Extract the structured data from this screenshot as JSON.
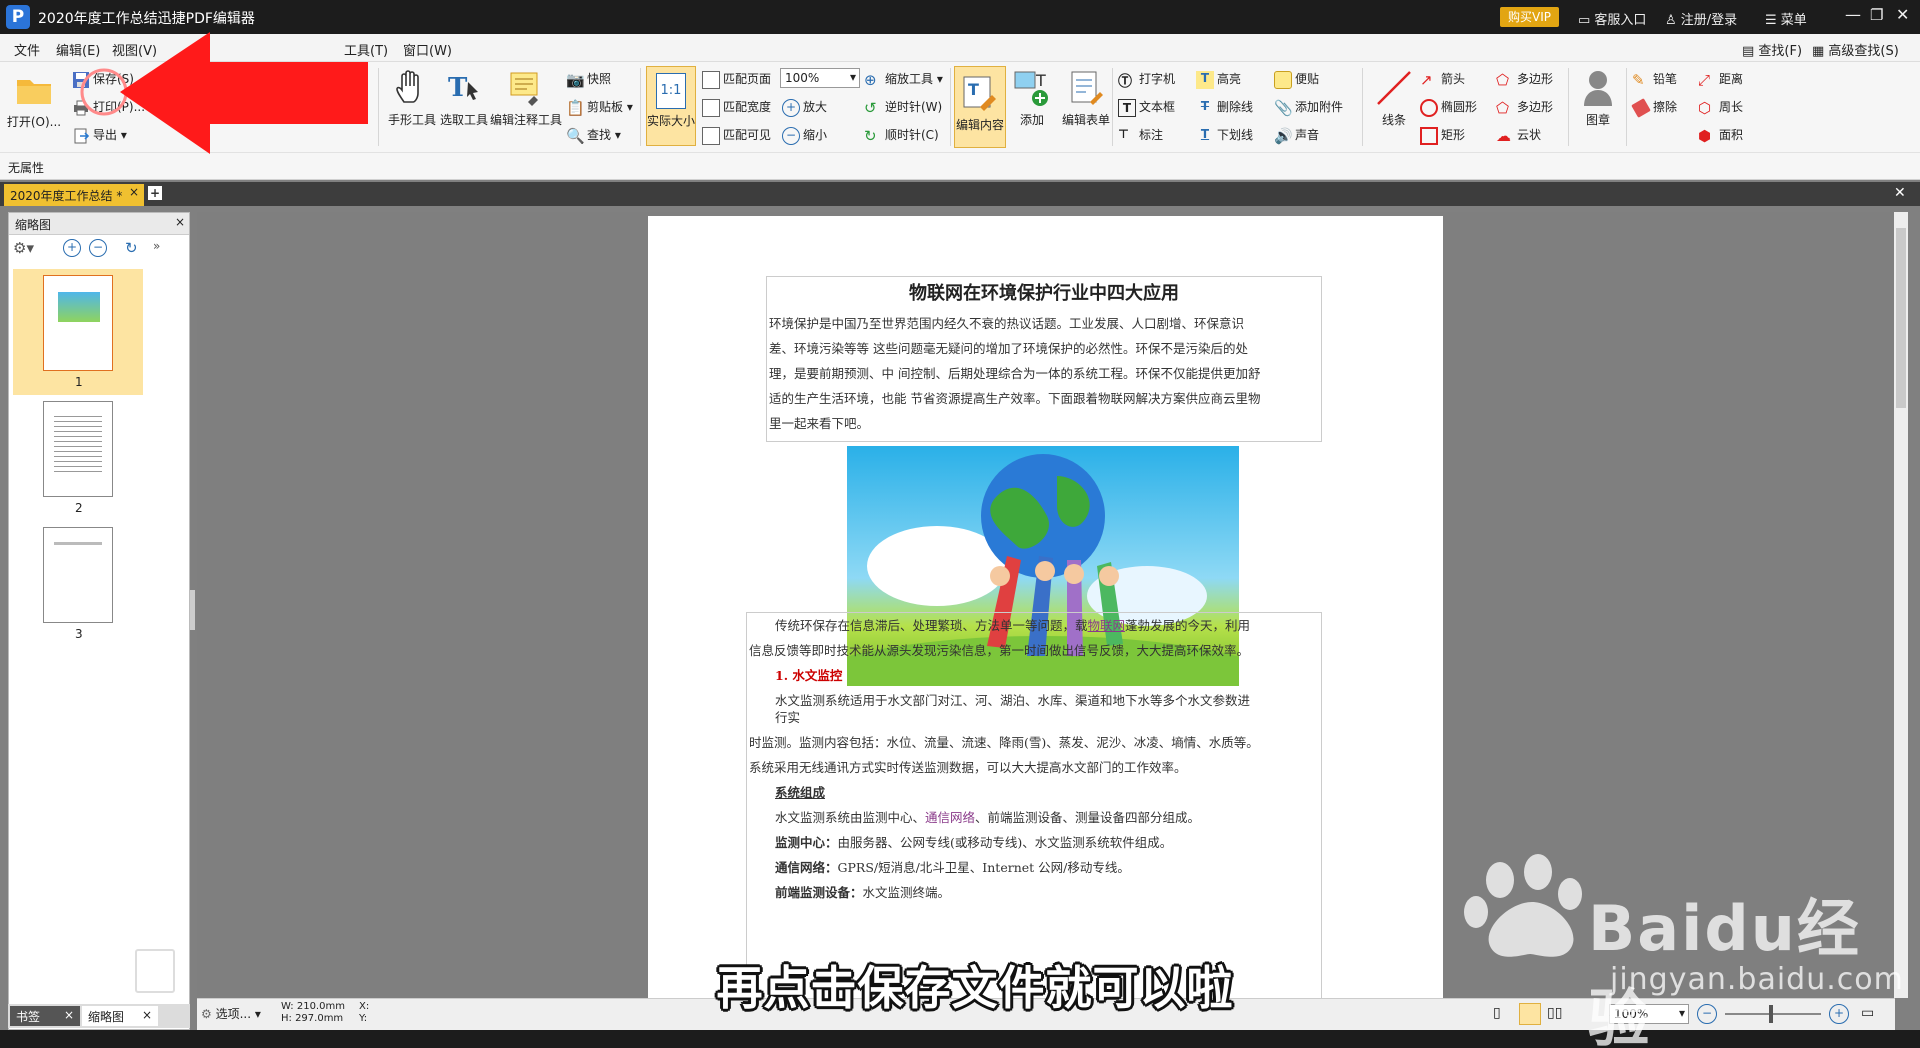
{
  "title_bar": {
    "title": "2020年度工作总结迅捷PDF编辑器",
    "vip": "购买VIP",
    "service": "客服入口",
    "login": "注册/登录",
    "menu": "菜单"
  },
  "menubar": {
    "items": [
      "文件",
      "编辑(E)",
      "视图(V)",
      "工具(T)",
      "窗口(W)"
    ],
    "find": "查找(F)",
    "advanced_find": "高级查找(S)"
  },
  "ribbon": {
    "open": "打开(O)...",
    "save": "保存(S)",
    "print": "打印(P)...",
    "export": "导出",
    "view_fragment": "视图",
    "hand_tool": "手形工具",
    "select_tool": "选取工具",
    "edit_annot": "编辑注释工具",
    "snapshot": "快照",
    "clipboard": "剪贴板",
    "find": "查找",
    "actual_size": "实际大小",
    "fit_page": "匹配页面",
    "fit_width": "匹配宽度",
    "fit_visible": "匹配可见",
    "zoom_value": "100%",
    "zoom_in": "放大",
    "zoom_out": "缩小",
    "zoom_tool": "缩放工具",
    "rotate_ccw": "逆时针(W)",
    "rotate_cw": "顺时针(C)",
    "edit_content": "编辑内容",
    "add": "添加",
    "edit_form": "编辑表单",
    "typewriter": "打字机",
    "textbox": "文本框",
    "callout": "标注",
    "highlight": "高亮",
    "strikeout": "删除线",
    "underline": "下划线",
    "note": "便贴",
    "attach": "添加附件",
    "sound": "声音",
    "line": "线条",
    "arrow": "箭头",
    "ellipse": "椭圆形",
    "rect": "矩形",
    "polygon1": "多边形",
    "polygon2": "多边形",
    "cloud": "云状",
    "stamp": "图章",
    "pencil": "铅笔",
    "eraser": "擦除",
    "distance": "距离",
    "perimeter": "周长",
    "area": "面积",
    "zoom_icon_label": "1:1"
  },
  "propbar": {
    "text": "无属性"
  },
  "tabs": [
    {
      "label": "2020年度工作总结 *"
    }
  ],
  "sidebar": {
    "title": "缩略图",
    "pages": [
      "1",
      "2",
      "3"
    ],
    "bottom_tabs": [
      "书签",
      "缩略图"
    ]
  },
  "document": {
    "heading": "物联网在环境保护行业中四大应用",
    "intro": [
      "环境保护是中国乃至世界范围内经久不衰的热议话题。工业发展、人口剧增、环保意识",
      "差、环境污染等等      这些问题毫无疑问的增加了环境保护的必然性。环保不是污染后的处",
      "理，是要前期预测、中    间控制、后期处理综合为一体的系统工程。环保不仅能提供更加舒",
      "适的生产生活环境，也能  节省资源提高生产效率。下面跟着物联网解决方案供应商云里物",
      "里一起来看下吧。"
    ],
    "para1_pre": "传统环保存在信息滞后、处理繁琐、方法单一等问题，载",
    "para1_link": "物联网",
    "para1_post": "蓬勃发展的今天，利用",
    "para1_line2": "信息反馈等即时技术能从源头发现污染信息，第一时间做出信号反馈，大大提高环保效率。",
    "section1": "1. 水文监控",
    "s1_line1": "水文监测系统适用于水文部门对江、河、湖泊、水库、渠道和地下水等多个水文参数进",
    "s1_line1b": "行实",
    "s1_line2": "时监测。监测内容包括：水位、流量、流速、降雨(雪)、蒸发、泥沙、冰凌、墒情、水质等。",
    "s1_line3": "系统采用无线通讯方式实时传送监测数据，可以大大提高水文部门的工作效率。",
    "system_heading": "系统组成",
    "sys_pre": "水文监测系统由监测中心、",
    "sys_link": "通信网络",
    "sys_post": "、前端监测设备、测量设备四部分组成。",
    "center_label": "监测中心：",
    "center_text": "由服务器、公网专线(或移动专线)、水文监测系统软件组成。",
    "network_label": "通信网络：",
    "network_text": "GPRS/短消息/北斗卫星、Internet 公网/移动专线。",
    "front_label": "前端监测设备：",
    "front_text": "水文监测终端。"
  },
  "statusbar": {
    "options": "选项...",
    "width": "W: 210.0mm",
    "height": "H: 297.0mm",
    "x": "X:",
    "y": "Y:",
    "zoom": "100%"
  },
  "overlay": {
    "subtitle": "再点击保存文件就可以啦",
    "watermark_main": "Baidu经验",
    "watermark_url": "jingyan.baidu.com"
  },
  "colors": {
    "accent_red": "#ff1a1a",
    "tab_yellow": "#f0c030",
    "vip": "#e2a512",
    "section_red": "#cc0000",
    "link_purple": "#8a3a8a"
  }
}
